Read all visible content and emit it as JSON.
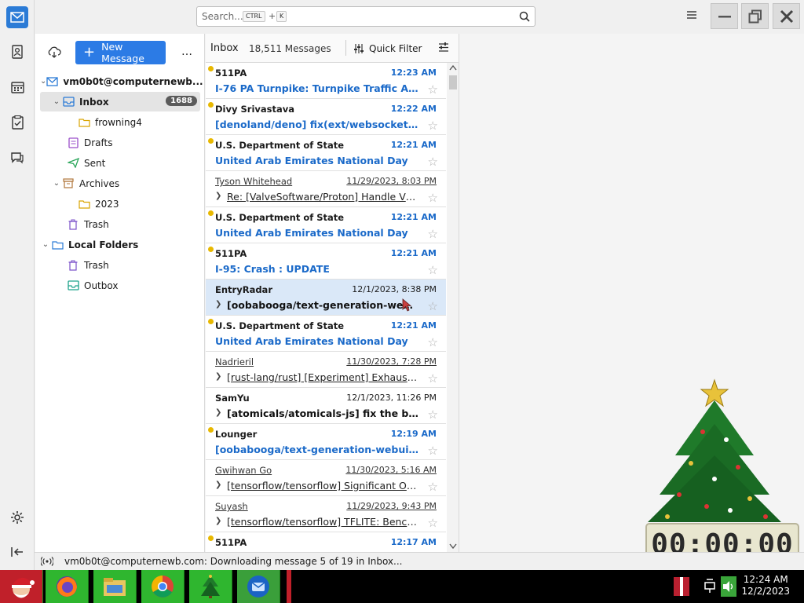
{
  "search": {
    "placeholder": "Search...",
    "shortcut_mod": "CTRL",
    "shortcut_plus": "+",
    "shortcut_key": "K"
  },
  "toolbar": {
    "new_message": "New Message",
    "more": "…"
  },
  "folders": {
    "account": "vm0b0t@computernewb...",
    "inbox": "Inbox",
    "inbox_badge": "1688",
    "frowning4": "frowning4",
    "drafts": "Drafts",
    "sent": "Sent",
    "archives": "Archives",
    "archives_2023": "2023",
    "trash": "Trash",
    "local_folders": "Local Folders",
    "local_trash": "Trash",
    "outbox": "Outbox"
  },
  "thread_header": {
    "folder": "Inbox",
    "count": "18,511 Messages",
    "quick_filter": "Quick Filter"
  },
  "messages": [
    {
      "from": "511PA",
      "date": "12:23 AM",
      "subject": "I-76 PA Turnpike: Turnpike Traffic Alert ..."
    },
    {
      "from": "Divy Srivastava",
      "date": "12:22 AM",
      "subject": "[denoland/deno] fix(ext/websocket): d..."
    },
    {
      "from": "U.S. Department of State",
      "date": "12:21 AM",
      "subject": "United Arab Emirates National Day"
    },
    {
      "from": "Tyson Whitehead",
      "date": "11/29/2023, 8:03 PM",
      "subject": "Re: [ValveSoftware/Proton] Handle VR s..."
    },
    {
      "from": "U.S. Department of State",
      "date": "12:21 AM",
      "subject": "United Arab Emirates National Day"
    },
    {
      "from": "511PA",
      "date": "12:21 AM",
      "subject": "I-95: Crash : UPDATE"
    },
    {
      "from": "EntryRadar",
      "date": "12/1/2023, 8:38 PM",
      "subject": "[oobabooga/text-generation-webui]..."
    },
    {
      "from": "U.S. Department of State",
      "date": "12:21 AM",
      "subject": "United Arab Emirates National Day"
    },
    {
      "from": "Nadrieril",
      "date": "11/30/2023, 7:28 PM",
      "subject": "[rust-lang/rust] [Experiment] Exhaustiven..."
    },
    {
      "from": "SamYu",
      "date": "12/1/2023, 11:26 PM",
      "subject": "[atomicals/atomicals-js] fix the bug c..."
    },
    {
      "from": "Lounger",
      "date": "12:19 AM",
      "subject": "[oobabooga/text-generation-webui] Gal..."
    },
    {
      "from": "Gwihwan Go",
      "date": "11/30/2023, 5:16 AM",
      "subject": "[tensorflow/tensorflow] Significant Outp..."
    },
    {
      "from": "Suyash",
      "date": "11/29/2023, 9:43 PM",
      "subject": "[tensorflow/tensorflow] TFLITE: Benchma..."
    },
    {
      "from": "511PA",
      "date": "12:17 AM",
      "subject": ""
    }
  ],
  "status": {
    "text": "vm0b0t@computernewb.com: Downloading message 5 of 19 in Inbox..."
  },
  "taskbar": {
    "time": "12:24 AM",
    "date": "12/2/2023"
  },
  "widget": {
    "timer": "00:00:00"
  },
  "colors": {
    "accent": "#2c7be5",
    "unread": "#1b6ac9",
    "taskbar_green": "#2fb62f"
  }
}
